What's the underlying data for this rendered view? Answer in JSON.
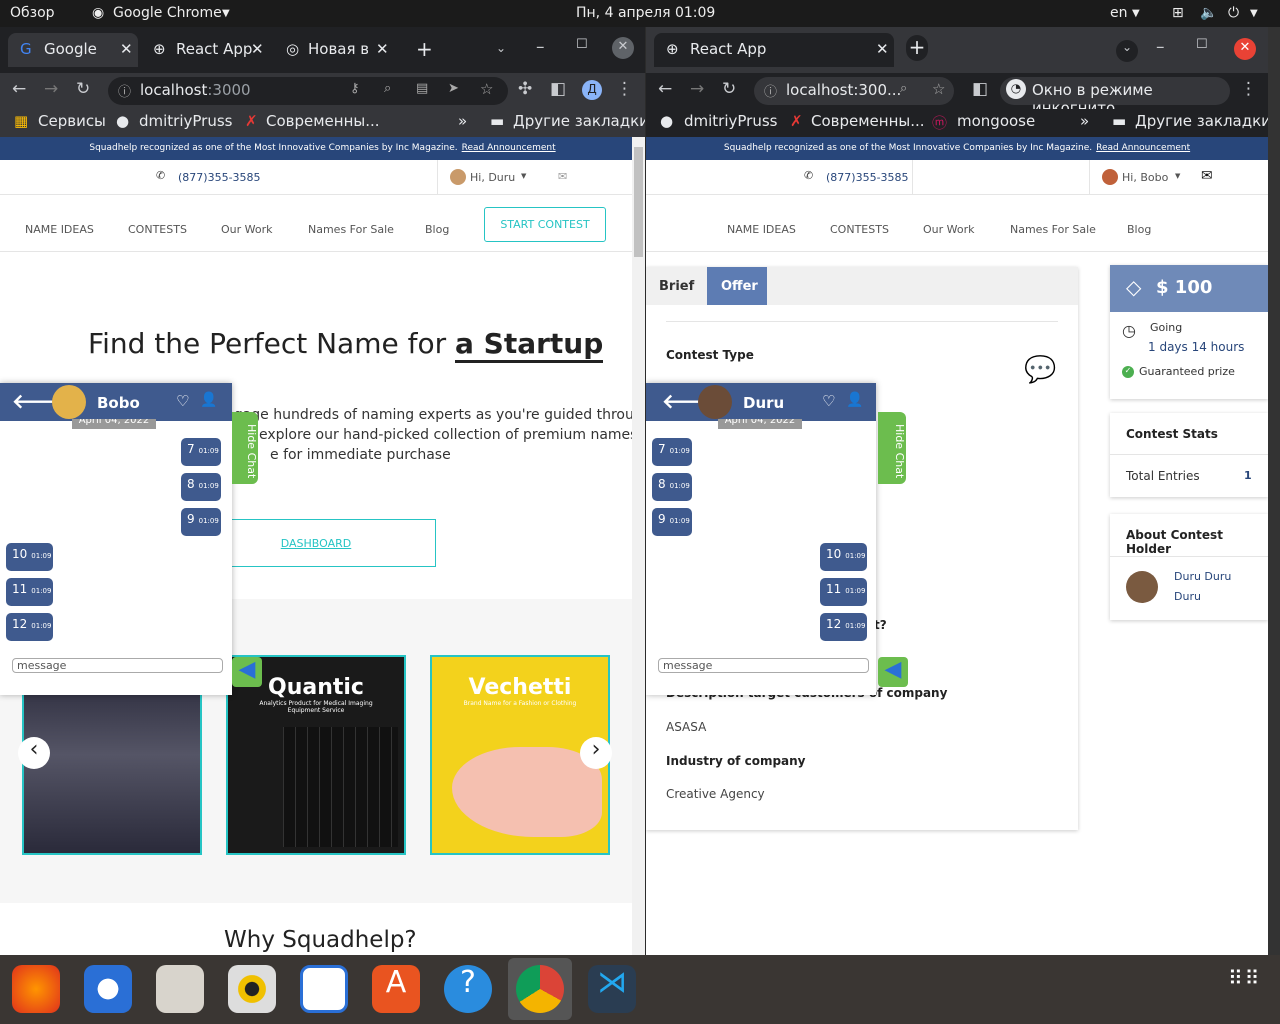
{
  "topbar": {
    "overview": "Обзор",
    "app": "Google Chrome",
    "clock": "Пн, 4 апреля  01:09",
    "lang": "en"
  },
  "left": {
    "tabs": [
      "Google",
      "React App",
      "Новая вкл"
    ],
    "url_host": "localhost",
    "url_port": ":3000",
    "bookmarks": [
      "Сервисы",
      "dmitriyPruss",
      "Современны...",
      "Другие закладки"
    ],
    "announce": "Squadhelp recognized as one of the Most Innovative Companies by Inc Magazine.",
    "announce_link": "Read Announcement",
    "phone": "(877)355-3585",
    "hi": "Hi, Duru",
    "nav": [
      "NAME IDEAS",
      "CONTESTS",
      "Our Work",
      "Names For Sale",
      "Blog"
    ],
    "start": "START CONTEST",
    "hero_title": "Find the Perfect Name for",
    "hero_bold": "a Startup",
    "hero_text1": "Launch a naming contest to engage hundreds of naming experts as you're guided through our",
    "hero_text2": "explore our hand-picked collection of premium names",
    "hero_text3": "e for immediate purchase",
    "dashboard": "DASHBOARD",
    "cards": [
      {
        "title": "",
        "sub": ""
      },
      {
        "title": "Quantic",
        "sub": "Analytics Product for Medical Imaging Equipment Service"
      },
      {
        "title": "Vechetti",
        "sub": "Brand Name for a Fashion or Clothing"
      }
    ],
    "why": "Why Squadhelp?",
    "chat": {
      "name": "Bobo",
      "date": "April 04, 2022",
      "hide": "Hide Chat",
      "placeholder": "message",
      "messages": [
        {
          "n": "7",
          "t": "01:09"
        },
        {
          "n": "8",
          "t": "01:09"
        },
        {
          "n": "9",
          "t": "01:09"
        },
        {
          "n": "10",
          "t": "01:09"
        },
        {
          "n": "11",
          "t": "01:09"
        },
        {
          "n": "12",
          "t": "01:09"
        }
      ]
    }
  },
  "right": {
    "tabs": [
      "React App"
    ],
    "url": "localhost:300...",
    "incognito": "Окно в режиме инкогнито",
    "bookmarks": [
      "dmitriyPruss",
      "Современны...",
      "mongoose",
      "Другие закладки"
    ],
    "announce": "Squadhelp recognized as one of the Most Innovative Companies by Inc Magazine.",
    "announce_link": "Read Announcement",
    "phone": "(877)355-3585",
    "hi": "Hi, Bobo",
    "nav": [
      "NAME IDEAS",
      "CONTESTS",
      "Our Work",
      "Names For Sale",
      "Blog"
    ],
    "brief_tab": "Brief",
    "offer_tab": "Offer",
    "contest_type": "Contest Type",
    "partial_q": "t?",
    "desc_label": "Description target customers of company",
    "desc_value": "ASASA",
    "industry_label": "Industry of company",
    "industry_value": "Creative Agency",
    "prize": "$ 100",
    "going": "Going",
    "remaining": "1 days 14 hours",
    "guaranteed": "Guaranteed prize",
    "stats_title": "Contest Stats",
    "total_label": "Total Entries",
    "total_value": "1",
    "holder_title": "About Contest Holder",
    "holder_name1": "Duru Duru",
    "holder_name2": "Duru",
    "chat": {
      "name": "Duru",
      "date": "April 04, 2022",
      "hide": "Hide Chat",
      "placeholder": "message",
      "messages": [
        {
          "n": "7",
          "t": "01:09"
        },
        {
          "n": "8",
          "t": "01:09"
        },
        {
          "n": "9",
          "t": "01:09"
        },
        {
          "n": "10",
          "t": "01:09"
        },
        {
          "n": "11",
          "t": "01:09"
        },
        {
          "n": "12",
          "t": "01:09"
        }
      ]
    }
  },
  "colors": {
    "brand": "#28467a",
    "chat": "#3f5a8e",
    "teal": "#26c4c4",
    "green": "#6cbd4e"
  }
}
